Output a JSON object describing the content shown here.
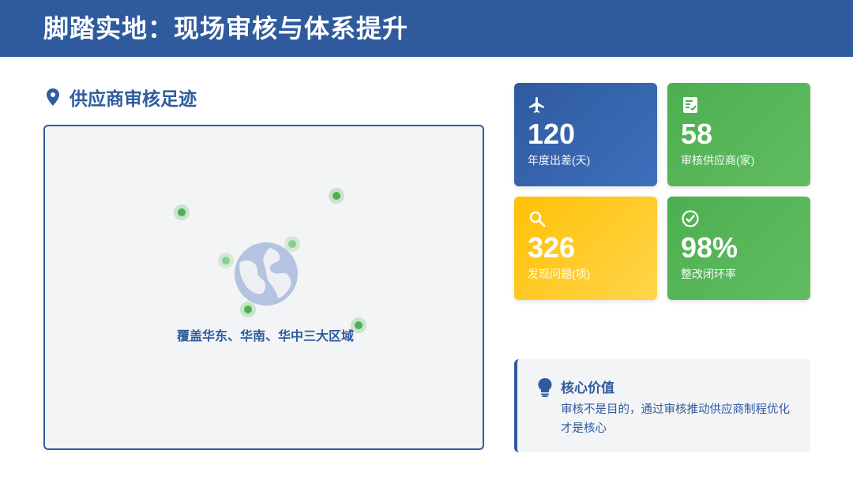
{
  "header": {
    "title": "脚踏实地：现场审核与体系提升"
  },
  "footprint": {
    "heading": "供应商审核足迹",
    "heading_icon": "map-pin-icon",
    "map_icon": "globe-icon",
    "coverage_text": "覆盖华东、华南、华中三大区域"
  },
  "stats": [
    {
      "icon": "airplane-icon",
      "value": "120",
      "label": "年度出差(天)",
      "color": "#2f5b9e"
    },
    {
      "icon": "checklist-icon",
      "value": "58",
      "label": "审核供应商(家)",
      "color": "#4caf50"
    },
    {
      "icon": "search-icon",
      "value": "326",
      "label": "发现问题(项)",
      "color": "#ffc107"
    },
    {
      "icon": "check-circle-icon",
      "value": "98%",
      "label": "整改闭环率",
      "color": "#4caf50"
    }
  ],
  "core_value": {
    "icon": "lightbulb-icon",
    "title": "核心价值",
    "text": "审核不是目的，通过审核推动供应商制程优化才是核心"
  }
}
